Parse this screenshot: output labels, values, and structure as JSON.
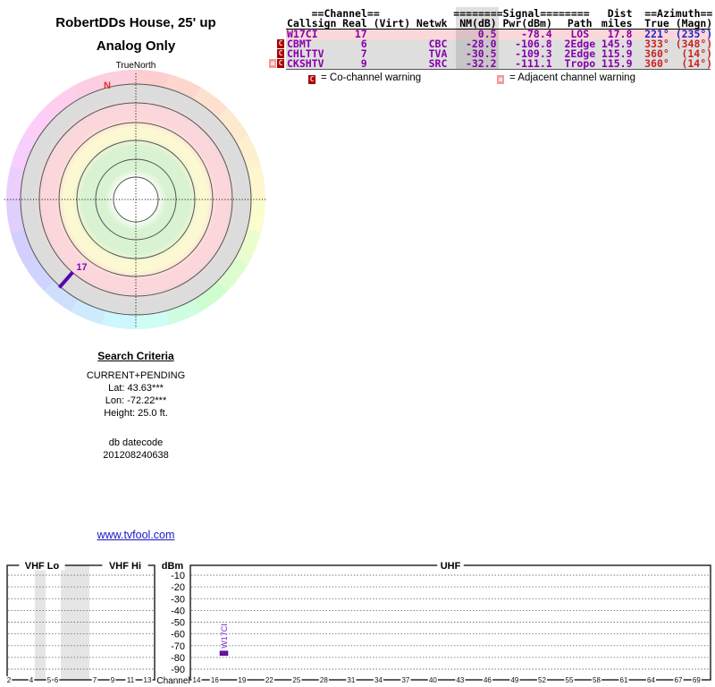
{
  "header": {
    "title": "RobertDDs House, 25' up",
    "subtitle": "Analog Only"
  },
  "radar": {
    "north_axis_label": "TrueNorth"
  },
  "table": {
    "group_headers": [
      "==Channel==",
      "========Signal========",
      "Dist",
      "==Azimuth=="
    ],
    "columns": [
      "Callsign",
      "Real",
      "(Virt)",
      "Netwk",
      "NM(dB)",
      "Pwr(dBm)",
      "Path",
      "miles",
      "True",
      "(Magn)"
    ],
    "text_color": "#8800aa",
    "rows": [
      {
        "warn": [],
        "bg": "#fbd7da",
        "az_color": "#2222cc",
        "callsign": "W17CI",
        "real": "17",
        "virt": "",
        "netwk": "",
        "nm": "0.5",
        "pwr": "-78.4",
        "path": "LOS",
        "miles": "17.8",
        "true_az": "221°",
        "magn": "(235°)"
      },
      {
        "warn": [
          "C"
        ],
        "bg": "#dedede",
        "az_color": "#cc2222",
        "callsign": "CBMT",
        "real": "6",
        "virt": "",
        "netwk": "CBC",
        "nm": "-28.0",
        "pwr": "-106.8",
        "path": "2Edge",
        "miles": "145.9",
        "true_az": "333°",
        "magn": "(348°)"
      },
      {
        "warn": [
          "C"
        ],
        "bg": "#dedede",
        "az_color": "#cc2222",
        "callsign": "CHLTTV",
        "real": "7",
        "virt": "",
        "netwk": "TVA",
        "nm": "-30.5",
        "pwr": "-109.3",
        "path": "2Edge",
        "miles": "115.9",
        "true_az": "360°",
        "magn": "(14°)"
      },
      {
        "warn": [
          "a",
          "C"
        ],
        "bg": "#dedede",
        "az_color": "#cc2222",
        "callsign": "CKSHTV",
        "real": "9",
        "virt": "",
        "netwk": "SRC",
        "nm": "-32.2",
        "pwr": "-111.1",
        "path": "Tropo",
        "miles": "115.9",
        "true_az": "360°",
        "magn": "(14°)"
      }
    ],
    "legend": [
      {
        "icon": "C",
        "label": "= Co-channel warning"
      },
      {
        "icon": "a",
        "label": "= Adjacent channel warning"
      }
    ]
  },
  "search": {
    "heading": "Search Criteria",
    "mode": "CURRENT+PENDING",
    "lat": "Lat: 43.63***",
    "lon": "Lon: -72.22***",
    "height": "Height: 25.0 ft.",
    "db_label": "db datecode",
    "db_code": "201208240638"
  },
  "link": "www.tvfool.com",
  "chart_data": [
    {
      "type": "polar",
      "title": "Azimuth coverage radar",
      "north_axis_label": "TrueNorth",
      "north_marker": {
        "label": "N",
        "color": "#e03030"
      },
      "zone_colors": {
        "center": "#ffffff",
        "inner_green": "#d9f2d2",
        "mid_yellow": "#fcf8d2",
        "outer_pink": "#fbd6da",
        "edge_gray": "#dcdcdc"
      },
      "rim": "pastel hue wheel by azimuth (pink N, yellow E, cyan S, blue SW, violet W)",
      "pointers": [
        {
          "label": "17",
          "azimuth_true_deg": 221,
          "color": "#5506b0"
        }
      ]
    },
    {
      "type": "bar",
      "ylabel": "dBm",
      "xlabel": "Channel",
      "ylim": [
        -97,
        0
      ],
      "yticks": [
        -10,
        -20,
        -30,
        -40,
        -50,
        -60,
        -70,
        -80,
        -90
      ],
      "grid": "dotted horizontal",
      "sections": [
        {
          "label": "VHF Lo",
          "channels": [
            2,
            4,
            5,
            6
          ]
        },
        {
          "label": "VHF Hi",
          "channels": [
            7,
            9,
            11,
            13
          ]
        },
        {
          "label": "UHF",
          "channels": [
            14,
            16,
            19,
            22,
            25,
            28,
            31,
            34,
            37,
            40,
            43,
            46,
            49,
            52,
            55,
            58,
            61,
            64,
            67,
            69
          ]
        }
      ],
      "bars": [
        {
          "label": "W17CI",
          "channel": 17,
          "power_dbm": -78.4,
          "color": "#6a0dad"
        }
      ],
      "notes": "gray bands mark unused spectrum between VHF channels 4-5 and 6-7"
    }
  ]
}
